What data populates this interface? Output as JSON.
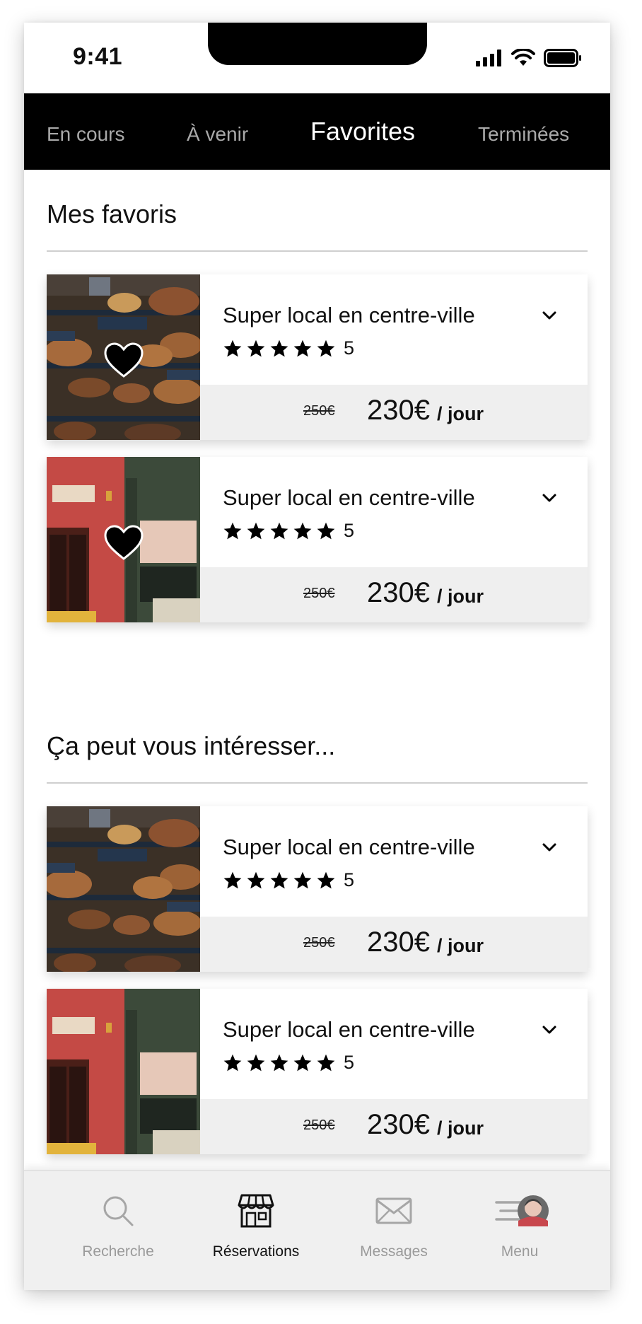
{
  "status_bar": {
    "time": "9:41"
  },
  "tabs": [
    {
      "label": "En cours",
      "active": false
    },
    {
      "label": "À venir",
      "active": false
    },
    {
      "label": "Favorites",
      "active": true
    },
    {
      "label": "Terminées",
      "active": false
    }
  ],
  "favorites": {
    "title": "Mes favoris",
    "cards": [
      {
        "title": "Super local en centre-ville",
        "rating": 5,
        "rating_text": "5",
        "old_price": "250€",
        "price": "230€",
        "per": "/ jour",
        "image": "bakery-photo",
        "favorite": true
      },
      {
        "title": "Super local en centre-ville",
        "rating": 5,
        "rating_text": "5",
        "old_price": "250€",
        "price": "230€",
        "per": "/ jour",
        "image": "storefront-photo",
        "favorite": true
      }
    ]
  },
  "suggestions": {
    "title": "Ça peut vous intéresser...",
    "cards": [
      {
        "title": "Super local en centre-ville",
        "rating": 5,
        "rating_text": "5",
        "old_price": "250€",
        "price": "230€",
        "per": "/ jour",
        "image": "bakery-photo",
        "favorite": false
      },
      {
        "title": "Super local en centre-ville",
        "rating": 5,
        "rating_text": "5",
        "old_price": "250€",
        "price": "230€",
        "per": "/ jour",
        "image": "storefront-photo",
        "favorite": false
      }
    ]
  },
  "bottom_nav": [
    {
      "label": "Recherche",
      "icon": "search-icon",
      "active": false
    },
    {
      "label": "Réservations",
      "icon": "store-icon",
      "active": true
    },
    {
      "label": "Messages",
      "icon": "mail-icon",
      "active": false
    },
    {
      "label": "Menu",
      "icon": "menu-icon",
      "active": false
    }
  ],
  "colors": {
    "tab_bar": "#000000",
    "active_tab": "#ffffff",
    "inactive_tab": "#a9a9a9",
    "card_footer": "#efefef"
  }
}
